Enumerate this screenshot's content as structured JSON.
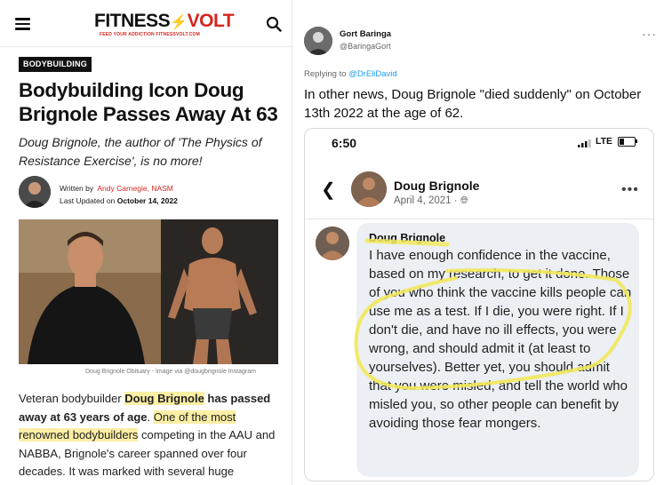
{
  "article": {
    "site_logo_word": "FITNESS",
    "site_logo_word2": "VOLT",
    "site_tagline": "FEED YOUR ADDICTION  FITNESSVOLT.COM",
    "category": "BODYBUILDING",
    "title": "Bodybuilding Icon Doug Brignole Passes Away At 63",
    "subtitle": "Doug Brignole, the author of 'The Physics of Resistance Exercise', is no more!",
    "written_by_label": "Written by",
    "author": "Andy Carnegie, NASM",
    "updated_label": "Last Updated on",
    "updated_date": "October 14, 2022",
    "image_caption": "Doug Brignole Obituary - Image via @dougbrignole Instagram",
    "body": {
      "p1": "Veteran bodybuilder ",
      "p2": "Doug Brignole",
      "p3": " has passed away at 63 years of age",
      "p4": ". ",
      "p5": "One of the most renowned bodybuilders",
      "p6": " competing in the AAU and NABBA, Brignole's career spanned over four decades. It was marked with several huge"
    }
  },
  "tweet": {
    "name": "Gort Baringa",
    "handle": "@BaringaGort",
    "more": "···",
    "replying_label": "Replying to ",
    "replying_to": "@DrEliDavid",
    "text": "In other news, Doug Brignole \"died suddenly\" on October 13th 2022 at the age of 62.",
    "screenshot": {
      "time": "6:50",
      "network": "LTE",
      "post_author": "Doug Brignole",
      "post_date": "April 4, 2021 ·",
      "comment_author": "Doug Brignole",
      "comment_text": "I have enough confidence in the vaccine, based on my research, to get it done. Those of you who think the vaccine kills people can use me as a test. If I die, you were right. If I don't die, and have no ill effects, you were wrong, and should admit it (at least to yourselves). Better yet, you should admit that you were misled, and tell the world who misled you, so other people can benefit by avoiding those fear mongers."
    }
  },
  "colors": {
    "brand_red": "#d4261f",
    "highlight": "#fbeea5",
    "marker_yellow": "#f2e85a",
    "twitter_blue": "#1d9bf0"
  }
}
